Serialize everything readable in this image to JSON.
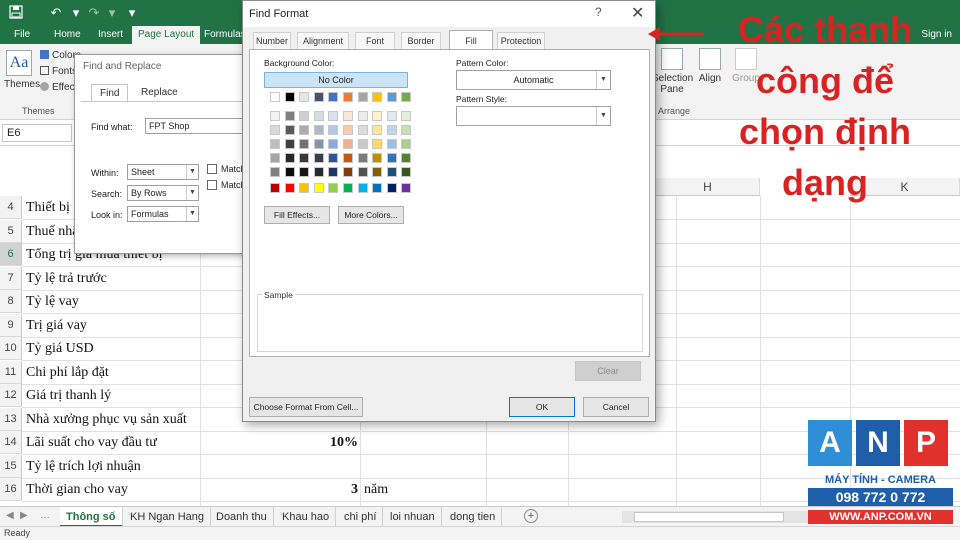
{
  "titlebar": {
    "icons": [
      "save-icon",
      "undo-icon",
      "redo-icon"
    ]
  },
  "ribbon_tabs": [
    "File",
    "Home",
    "Insert",
    "Page Layout",
    "Formulas"
  ],
  "signin": "Sign in",
  "ribbon": {
    "themes_button": "Themes",
    "themes_group": "Themes",
    "colors": "Colors",
    "fonts": "Fonts",
    "effects": "Effects",
    "selection_pane": "Selection Pane",
    "align": "Align",
    "group": "Group",
    "arrange_group": "Arrange"
  },
  "namebox": "E6",
  "columns": {
    "h": "H",
    "k": "K"
  },
  "rows": [
    {
      "num": "4",
      "a": "Thiết bị",
      "c": "",
      "d": ""
    },
    {
      "num": "5",
      "a": "Thuế nhậ",
      "c": "",
      "d": ""
    },
    {
      "num": "6",
      "a": "Tổng trị giá mua thiết bị",
      "c": "",
      "d": ""
    },
    {
      "num": "7",
      "a": "Tỷ lệ trả trước",
      "c": "",
      "d": ""
    },
    {
      "num": "8",
      "a": "Tỷ lệ vay",
      "c": "",
      "d": ""
    },
    {
      "num": "9",
      "a": "Trị giá vay",
      "c": "",
      "d": ""
    },
    {
      "num": "10",
      "a": "Tỷ giá USD",
      "c": "",
      "d": ""
    },
    {
      "num": "11",
      "a": "Chi phí lắp đặt",
      "c": "",
      "d": ""
    },
    {
      "num": "12",
      "a": "Giá trị thanh lý",
      "c": "",
      "d": ""
    },
    {
      "num": "13",
      "a": "Nhà xưởng phục vụ sản xuất",
      "c": "",
      "d": ""
    },
    {
      "num": "14",
      "a": "Lãi suất cho vay đầu tư",
      "c": "10%",
      "d": ""
    },
    {
      "num": "15",
      "a": "Tỷ lệ trích lợi nhuận",
      "c": "",
      "d": ""
    },
    {
      "num": "16",
      "a": "Thời gian cho vay",
      "c": "3",
      "d": "năm"
    }
  ],
  "sheet_tabs": [
    "Thông số",
    "KH Ngan Hang",
    "Doanh thu",
    "Khau hao",
    "chi phí",
    "loi nhuan",
    "dong tien"
  ],
  "status": "Ready",
  "find_replace": {
    "title": "Find and Replace",
    "tab_find": "Find",
    "tab_replace": "Replace",
    "find_what_label": "Find what:",
    "find_what_value": "FPT Shop",
    "within_label": "Within:",
    "within_value": "Sheet",
    "search_label": "Search:",
    "search_value": "By Rows",
    "lookin_label": "Look in:",
    "lookin_value": "Formulas",
    "match1": "Match",
    "match2": "Match"
  },
  "find_format": {
    "title": "Find Format",
    "help": "?",
    "tabs": [
      "Number",
      "Alignment",
      "Font",
      "Border",
      "Fill",
      "Protection"
    ],
    "background_color_label": "Background Color:",
    "no_color_label": "No Color",
    "pattern_color_label": "Pattern Color:",
    "pattern_color_value": "Automatic",
    "pattern_style_label": "Pattern Style:",
    "fill_effects_label": "Fill Effects...",
    "more_colors_label": "More Colors...",
    "sample_label": "Sample",
    "clear_label": "Clear",
    "choose_format_label": "Choose Format From Cell...",
    "ok_label": "OK",
    "cancel_label": "Cancel",
    "palette_top": [
      "#ffffff",
      "#000000",
      "#e7e6e6",
      "#44546a",
      "#4472c4",
      "#ed7d31",
      "#a5a5a5",
      "#ffc000",
      "#5b9bd5",
      "#70ad47"
    ],
    "palette_shades": [
      [
        "#f2f2f2",
        "#808080",
        "#d0cece",
        "#d6dce4",
        "#d9e1f2",
        "#fce4d6",
        "#ededed",
        "#fff2cc",
        "#ddebf7",
        "#e2efda"
      ],
      [
        "#d9d9d9",
        "#595959",
        "#aeaaaa",
        "#acb9ca",
        "#b4c6e7",
        "#f8cbad",
        "#dbdbdb",
        "#ffe699",
        "#bdd7ee",
        "#c6e0b4"
      ],
      [
        "#bfbfbf",
        "#404040",
        "#757171",
        "#8497b0",
        "#8ea9db",
        "#f4b084",
        "#c9c9c9",
        "#ffd966",
        "#9bc2e6",
        "#a9d08e"
      ],
      [
        "#a6a6a6",
        "#262626",
        "#3a3838",
        "#333f4f",
        "#305496",
        "#c65911",
        "#7b7b7b",
        "#bf8f00",
        "#2f75b5",
        "#548235"
      ],
      [
        "#808080",
        "#0d0d0d",
        "#161616",
        "#222b35",
        "#203764",
        "#833c0c",
        "#525252",
        "#806000",
        "#1f4e78",
        "#375623"
      ]
    ],
    "palette_standard": [
      "#c00000",
      "#ff0000",
      "#ffc000",
      "#ffff00",
      "#92d050",
      "#00b050",
      "#00b0f0",
      "#0070c0",
      "#002060",
      "#7030a0"
    ]
  },
  "annotation": {
    "lines": [
      "Các thanh",
      "công để",
      "chọn định",
      "dạng"
    ],
    "color": "#d92323"
  },
  "logo": {
    "letters": [
      "A",
      "N",
      "P"
    ],
    "colors": [
      "#2f8fd6",
      "#1f5ea8",
      "#e0312d"
    ],
    "tagline": "MÁY TÍNH - CAMERA",
    "phone": "098 772 0 772",
    "website": "WWW.ANP.COM.VN"
  }
}
